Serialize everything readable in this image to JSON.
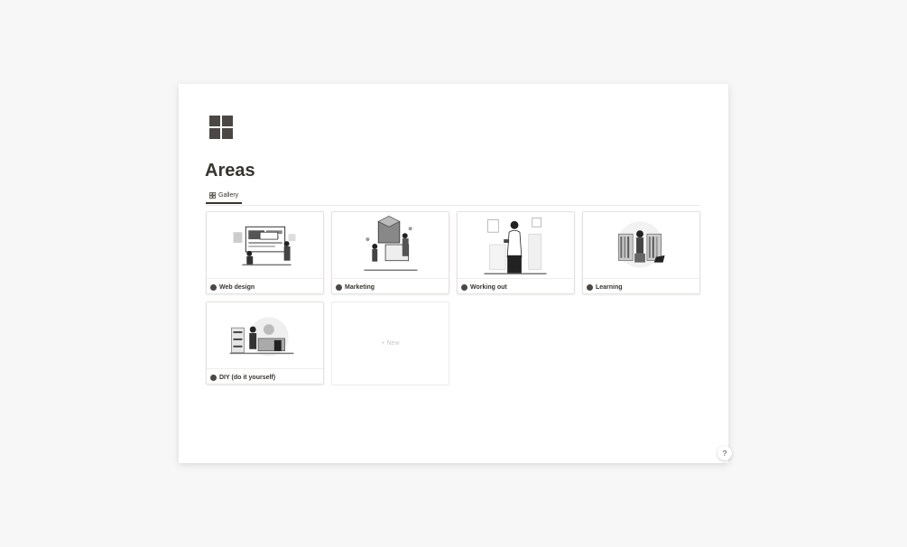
{
  "page": {
    "icon": "grid-icon",
    "title": "Areas"
  },
  "tabs": [
    {
      "label": "Gallery",
      "icon": "gallery-grid-icon"
    }
  ],
  "cards": [
    {
      "label": "Web design",
      "illustration": "web-design-illustration"
    },
    {
      "label": "Marketing",
      "illustration": "marketing-illustration"
    },
    {
      "label": "Working out",
      "illustration": "working-out-illustration"
    },
    {
      "label": "Learning",
      "illustration": "learning-illustration"
    },
    {
      "label": "DIY (do it yourself)",
      "illustration": "diy-illustration"
    }
  ],
  "new_card": {
    "label": "+ New"
  },
  "help": {
    "label": "?"
  },
  "colors": {
    "background": "#f7f7f7",
    "page": "#ffffff",
    "text": "#37352f",
    "dot": "#4a4744"
  }
}
